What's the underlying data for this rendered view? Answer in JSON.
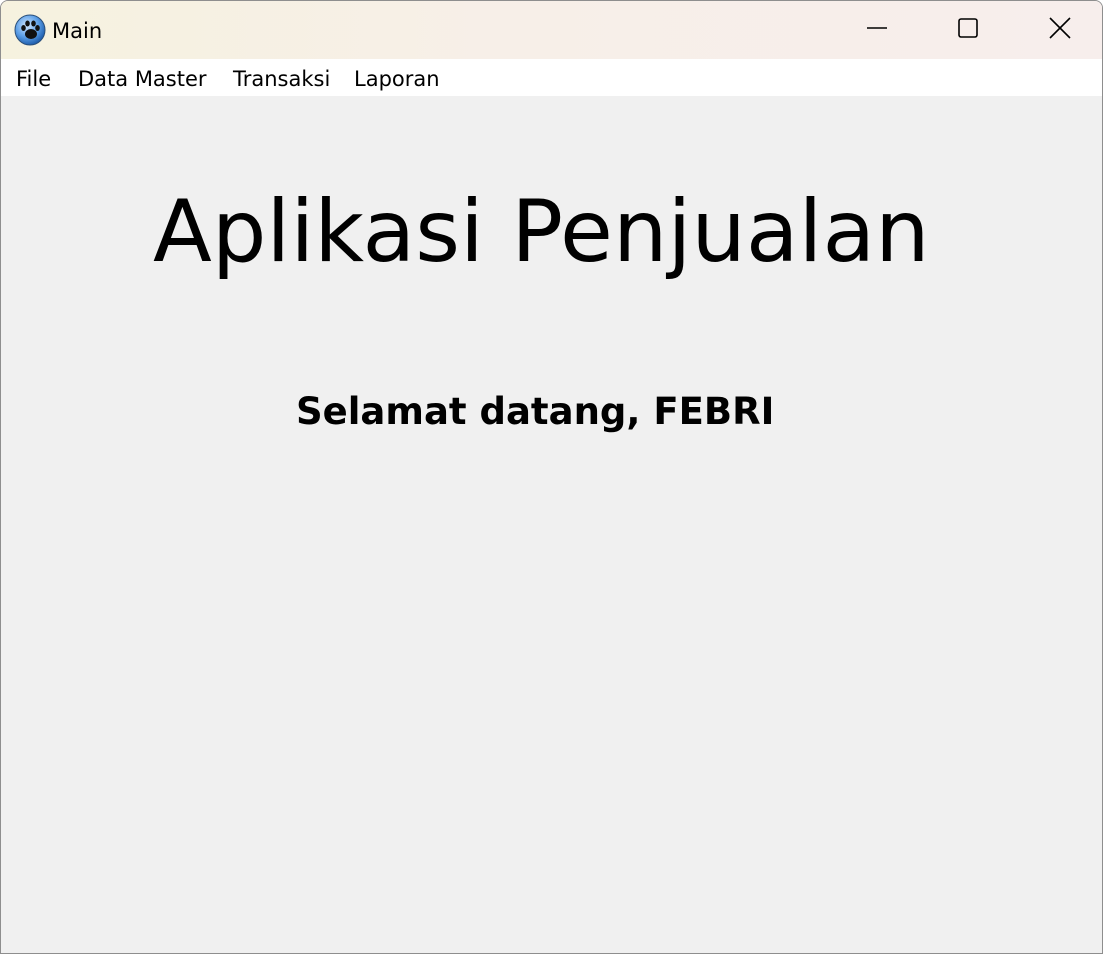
{
  "window": {
    "title": "Main",
    "controls": {
      "minimize": "minimize",
      "maximize": "maximize",
      "close": "close"
    }
  },
  "menu": {
    "items": [
      {
        "label": "File"
      },
      {
        "label": "Data Master"
      },
      {
        "label": "Transaksi"
      },
      {
        "label": "Laporan"
      }
    ]
  },
  "main": {
    "heading": "Aplikasi Penjualan",
    "welcome": "Selamat datang, FEBRI"
  },
  "icons": {
    "app": "paw-icon",
    "minimize": "minimize-icon",
    "maximize": "maximize-icon",
    "close": "close-icon"
  },
  "colors": {
    "content_bg": "#f0f0f0",
    "menubar_bg": "#ffffff",
    "app_icon_blue": "#3b7fd0"
  }
}
